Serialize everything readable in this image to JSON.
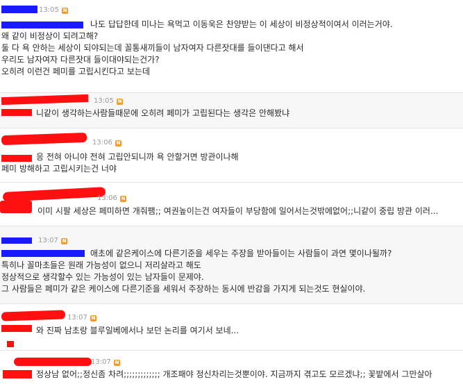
{
  "comments": [
    {
      "time": "13:05",
      "badge": "N",
      "lines": [
        "나도 답답한데 미나는 욕먹고 이동욱은 찬양받는 이 세상이 비정상적이여서 이러는거야.",
        "왜 같이 비정상이 되려고해?",
        "둘 다 욕 안하는 세상이 되야되는데 꼴통새끼들이 남자여자 다른잣대를 들이댄다고 해서",
        "우리도 남자여자 다른잣대 들이대야되는건가?",
        "오히려 이런건 페미를 고립시킨다고 보는데"
      ]
    },
    {
      "time": "13:05",
      "badge": "N",
      "lines": [
        "니같이 생각하는사람들때문에 오히려 페미가 고립된다는 생각은 안해봤냐"
      ]
    },
    {
      "time": "13:06",
      "badge": "N",
      "lines": [
        "응 전혀 아니야 전혀 고립안되니까 욕 안할거면 방관이나해",
        "페미 방해하고 고립시키는건 너야"
      ]
    },
    {
      "time": "13:06",
      "badge": "N",
      "lines": [
        "이미 시팔 세상은 페미하면 개줘팸;; 여권높이는건 여자들이 부당함에 일어서는것밖에없어;;니같이 중립 방관 이러..."
      ]
    },
    {
      "time": "13:07",
      "badge": "N",
      "lines": [
        "애초에 같은케이스에 다른기준을 세우는 주장을 받아들이는 사람들이 과연 몇이나될까?",
        "특히나 꼴마초들은 원래 가능성이 없으니 저리살라고 해도",
        "정상적으로 생각할수 있는 가능성이 있는 남자들이 문제야.",
        "그 사람들은 페미가 같은 케이스에 다른기준을 세워서 주장하는 동시에 반감을 가지게 되는것도 현실이야."
      ]
    },
    {
      "time": "13:07",
      "badge": "N",
      "lines": [
        "와 진짜 남초랑 블루일베에서나 보던 논리를 여기서 보네..."
      ]
    },
    {
      "time": "13:07",
      "badge": "N",
      "lines": [
        "정상남 없어;;정신좀 차려;;;;;;;;;;;;; 개조패야 정신차리는것뿐이야. 지금까지 겪고도 모르겠냐;; 꽃밭에서 그만살아"
      ]
    }
  ]
}
